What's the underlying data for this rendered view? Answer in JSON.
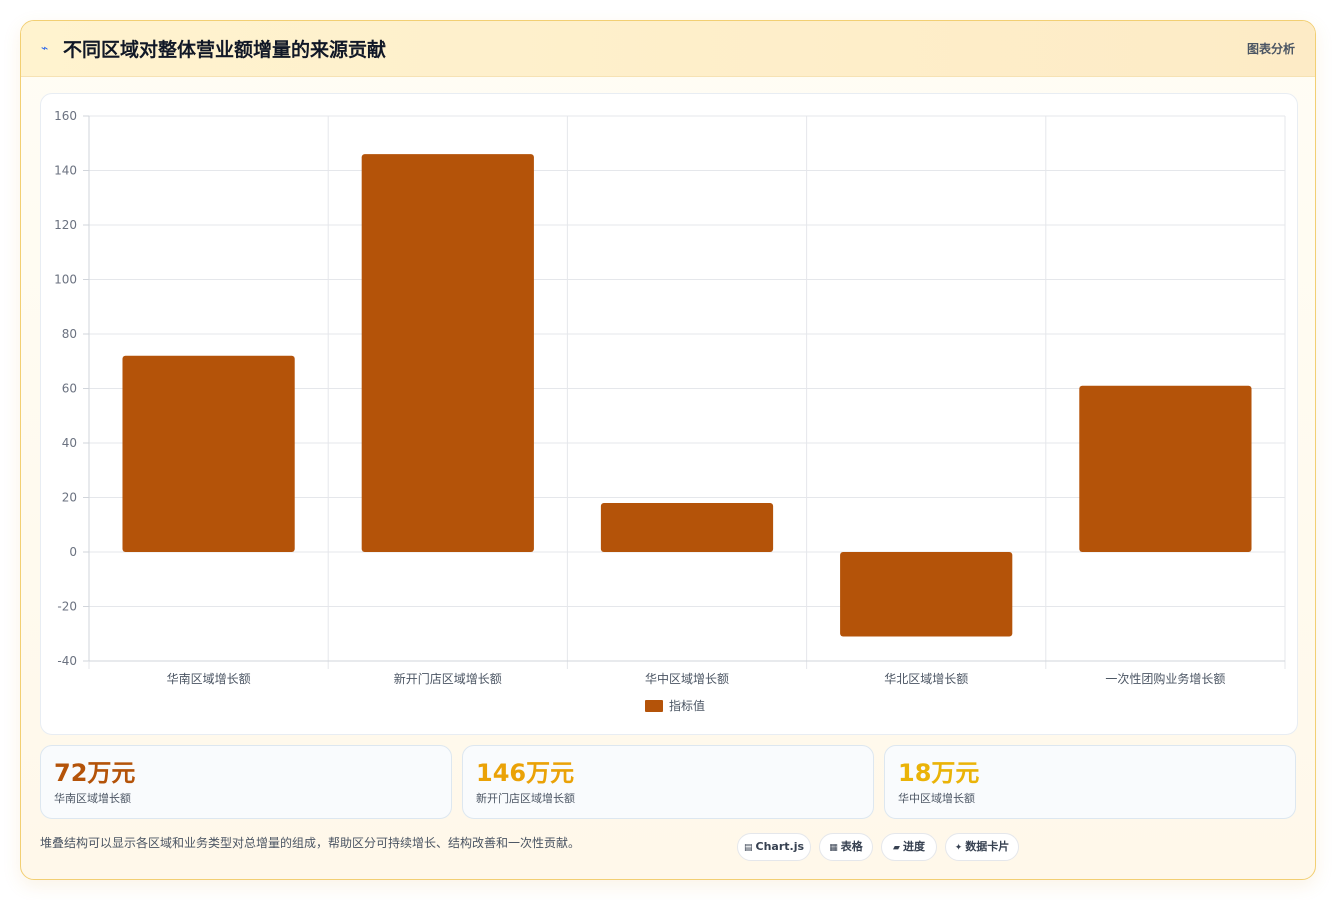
{
  "header": {
    "icon": "chart-line-icon",
    "title": "不同区域对整体营业额增量的来源贡献",
    "tag": "图表分析"
  },
  "chart_data": {
    "type": "bar",
    "categories": [
      "华南区域增长额",
      "新开门店区域增长额",
      "华中区域增长额",
      "华北区域增长额",
      "一次性团购业务增长额"
    ],
    "series": [
      {
        "name": "指标值",
        "values": [
          72,
          146,
          18,
          -31,
          61
        ],
        "color": "#b45309"
      }
    ],
    "ylim": [
      -40,
      160
    ],
    "yticks": [
      -40,
      -20,
      0,
      20,
      40,
      60,
      80,
      100,
      120,
      140,
      160
    ],
    "grid": true,
    "legend": "bottom"
  },
  "kpis": [
    {
      "value": "72万元",
      "label": "华南区域增长额",
      "color": "#b45309"
    },
    {
      "value": "146万元",
      "label": "新开门店区域增长额",
      "color": "#eaa207"
    },
    {
      "value": "18万元",
      "label": "华中区域增长额",
      "color": "#eab308"
    }
  ],
  "footer": {
    "text": "堆叠结构可以显示各区域和业务类型对总增量的组成，帮助区分可持续增长、结构改善和一次性贡献。",
    "chips": [
      {
        "icon": "bar-chart-icon",
        "label": "Chart.js"
      },
      {
        "icon": "table-icon",
        "label": "表格"
      },
      {
        "icon": "progress-icon",
        "label": "进度"
      },
      {
        "icon": "sparkle-icon",
        "label": "数据卡片"
      }
    ]
  }
}
